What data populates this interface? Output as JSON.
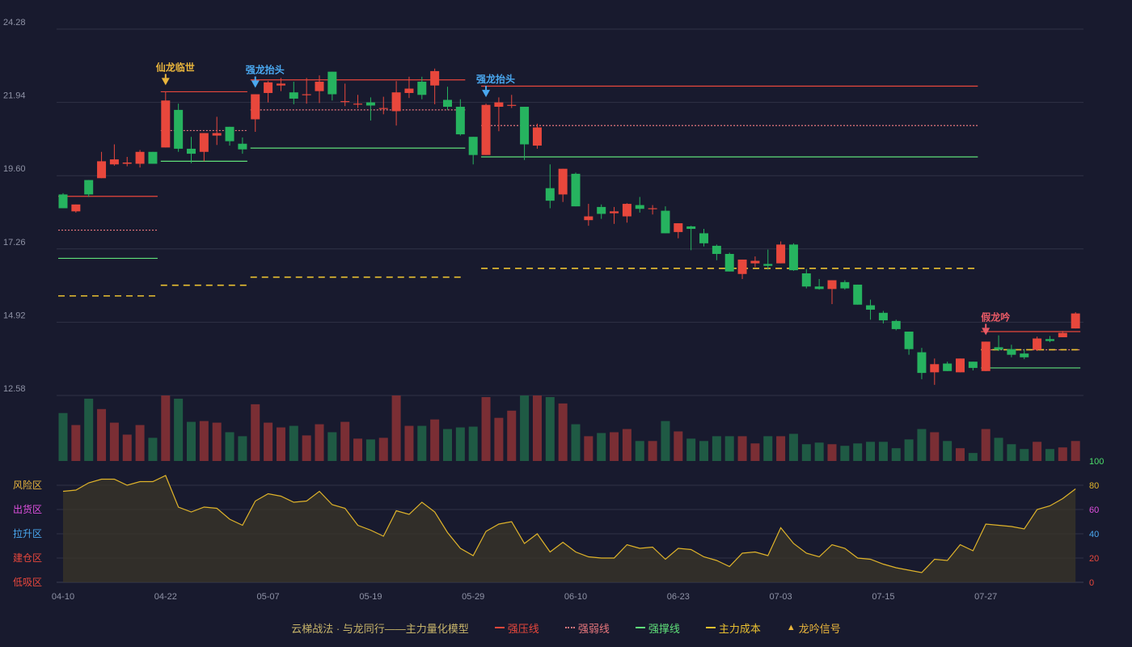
{
  "colors": {
    "background": "#181a2e",
    "up": "#e8473c",
    "down": "#26b35f",
    "up_volume": "#7a2e34",
    "down_volume": "#1f5a44",
    "grid": "#2f3246",
    "strong_pressure": "#e8473c",
    "strong_weak": "#e8777d",
    "strong_support": "#5fe07a",
    "main_cost": "#e9c030",
    "osc_line": "#e0b42a"
  },
  "chart_data": {
    "type": "candlestick",
    "x_ticks": [
      "04-10",
      "04-22",
      "05-07",
      "05-19",
      "05-29",
      "06-10",
      "06-23",
      "07-03",
      "07-15",
      "07-27"
    ],
    "x_tick_index": [
      0,
      8,
      16,
      24,
      32,
      40,
      48,
      56,
      64,
      72
    ],
    "price_axis": {
      "ticks": [
        24.28,
        21.94,
        19.6,
        17.26,
        14.92,
        12.58
      ],
      "ylim": [
        12.58,
        24.28
      ]
    },
    "candles": [
      [
        19.0,
        18.56,
        18.56,
        19.04
      ],
      [
        18.46,
        18.68,
        18.42,
        18.68
      ],
      [
        19.46,
        19.0,
        18.92,
        19.46
      ],
      [
        19.52,
        20.06,
        19.52,
        20.36
      ],
      [
        19.96,
        20.12,
        19.92,
        20.6
      ],
      [
        19.98,
        20.02,
        19.9,
        20.2
      ],
      [
        19.98,
        20.36,
        19.86,
        20.42
      ],
      [
        20.36,
        19.98,
        19.98,
        20.36
      ],
      [
        20.5,
        22.0,
        20.5,
        22.28
      ],
      [
        21.7,
        20.46,
        20.36,
        21.9
      ],
      [
        20.46,
        20.3,
        20.0,
        20.84
      ],
      [
        20.36,
        20.96,
        20.06,
        20.96
      ],
      [
        20.88,
        20.96,
        20.58,
        21.48
      ],
      [
        21.16,
        20.7,
        20.56,
        21.16
      ],
      [
        20.62,
        20.44,
        20.3,
        20.82
      ],
      [
        21.4,
        22.2,
        21.0,
        22.2
      ],
      [
        22.24,
        22.58,
        21.94,
        22.62
      ],
      [
        22.48,
        22.54,
        22.3,
        22.72
      ],
      [
        22.26,
        22.06,
        21.88,
        22.6
      ],
      [
        22.2,
        22.2,
        21.9,
        22.72
      ],
      [
        22.3,
        22.6,
        21.92,
        22.8
      ],
      [
        22.92,
        22.2,
        22.0,
        22.92
      ],
      [
        21.98,
        21.98,
        21.82,
        22.54
      ],
      [
        21.9,
        21.9,
        21.76,
        22.18
      ],
      [
        21.94,
        21.84,
        21.36,
        22.1
      ],
      [
        21.76,
        21.76,
        21.56,
        22.12
      ],
      [
        21.66,
        22.26,
        21.2,
        22.62
      ],
      [
        22.24,
        22.38,
        22.08,
        22.76
      ],
      [
        22.6,
        22.18,
        22.04,
        22.76
      ],
      [
        22.48,
        22.94,
        21.88,
        23.02
      ],
      [
        22.02,
        21.8,
        21.7,
        22.44
      ],
      [
        21.8,
        20.92,
        20.88,
        22.04
      ],
      [
        20.84,
        20.26,
        19.96,
        20.84
      ],
      [
        20.26,
        21.86,
        20.26,
        21.9
      ],
      [
        21.8,
        21.94,
        21.02,
        22.1
      ],
      [
        21.84,
        21.86,
        21.76,
        22.18
      ],
      [
        21.8,
        20.6,
        20.1,
        21.8
      ],
      [
        20.56,
        21.14,
        20.46,
        21.26
      ],
      [
        19.2,
        18.8,
        18.56,
        19.96
      ],
      [
        19.0,
        19.82,
        18.76,
        19.82
      ],
      [
        19.66,
        18.62,
        18.62,
        19.7
      ],
      [
        18.18,
        18.3,
        18.0,
        18.7
      ],
      [
        18.6,
        18.38,
        18.22,
        18.68
      ],
      [
        18.4,
        18.46,
        18.06,
        18.6
      ],
      [
        18.3,
        18.7,
        18.1,
        18.72
      ],
      [
        18.66,
        18.54,
        18.42,
        18.92
      ],
      [
        18.56,
        18.56,
        18.36,
        18.66
      ],
      [
        18.48,
        17.76,
        17.76,
        18.62
      ],
      [
        17.8,
        18.08,
        17.6,
        18.08
      ],
      [
        17.98,
        17.9,
        17.22,
        18.0
      ],
      [
        17.76,
        17.44,
        17.34,
        17.9
      ],
      [
        17.36,
        17.1,
        16.9,
        17.4
      ],
      [
        17.1,
        16.54,
        16.54,
        17.14
      ],
      [
        16.46,
        16.92,
        16.3,
        16.92
      ],
      [
        16.8,
        16.88,
        16.68,
        17.02
      ],
      [
        16.78,
        16.72,
        16.6,
        17.24
      ],
      [
        16.8,
        17.4,
        16.8,
        17.5
      ],
      [
        17.4,
        16.58,
        16.56,
        17.44
      ],
      [
        16.48,
        16.06,
        16.0,
        16.62
      ],
      [
        16.06,
        15.98,
        15.96,
        16.3
      ],
      [
        15.98,
        16.26,
        15.5,
        16.26
      ],
      [
        16.2,
        16.0,
        15.96,
        16.26
      ],
      [
        16.12,
        15.48,
        15.48,
        16.12
      ],
      [
        15.46,
        15.32,
        15.0,
        15.64
      ],
      [
        15.22,
        14.98,
        14.88,
        15.28
      ],
      [
        14.96,
        14.7,
        14.66,
        15.0
      ],
      [
        14.62,
        14.06,
        13.88,
        14.62
      ],
      [
        13.96,
        13.3,
        13.1,
        14.1
      ],
      [
        13.32,
        13.58,
        12.92,
        13.76
      ],
      [
        13.6,
        13.36,
        13.36,
        13.66
      ],
      [
        13.32,
        13.76,
        13.32,
        13.76
      ],
      [
        13.66,
        13.46,
        13.38,
        13.66
      ],
      [
        13.36,
        14.3,
        13.36,
        14.3
      ],
      [
        14.12,
        14.04,
        14.0,
        14.5
      ],
      [
        14.06,
        13.88,
        13.8,
        14.2
      ],
      [
        13.92,
        13.8,
        13.74,
        14.06
      ],
      [
        14.04,
        14.4,
        14.0,
        14.46
      ],
      [
        14.38,
        14.32,
        14.28,
        14.48
      ],
      [
        14.44,
        14.58,
        14.44,
        14.64
      ],
      [
        14.72,
        15.2,
        14.72,
        15.24
      ]
    ],
    "volume": [
      60,
      45,
      78,
      65,
      48,
      33,
      45,
      29,
      82,
      78,
      49,
      50,
      48,
      36,
      31,
      71,
      48,
      42,
      44,
      32,
      46,
      36,
      49,
      28,
      27,
      29,
      82,
      44,
      44,
      52,
      40,
      42,
      43,
      80,
      54,
      63,
      82,
      82,
      80,
      72,
      46,
      31,
      35,
      36,
      40,
      25,
      25,
      50,
      37,
      28,
      25,
      31,
      31,
      31,
      22,
      31,
      31,
      34,
      21,
      23,
      21,
      19,
      22,
      24,
      24,
      16,
      27,
      40,
      36,
      25,
      16,
      10,
      40,
      29,
      21,
      15,
      24,
      15,
      17,
      25
    ],
    "osc_axis": {
      "ticks": [
        0,
        20,
        40,
        60,
        80,
        100
      ]
    },
    "osc_zones": [
      "风险区",
      "出货区",
      "拉升区",
      "建仓区",
      "低吸区"
    ],
    "osc_values": [
      75,
      76,
      82,
      85,
      85,
      80,
      83,
      83,
      88,
      62,
      58,
      62,
      61,
      52,
      47,
      67,
      73,
      71,
      66,
      67,
      75,
      64,
      61,
      47,
      43,
      38,
      59,
      56,
      66,
      58,
      41,
      28,
      22,
      42,
      48,
      50,
      32,
      40,
      25,
      33,
      25,
      21,
      20,
      20,
      31,
      28,
      29,
      19,
      28,
      27,
      21,
      18,
      13,
      24,
      25,
      22,
      45,
      32,
      24,
      21,
      31,
      28,
      20,
      19,
      15,
      12,
      10,
      8,
      19,
      18,
      31,
      26,
      48,
      47,
      46,
      44,
      60,
      63,
      69,
      77
    ],
    "segments": [
      {
        "start": 0,
        "end": 7,
        "strong_pressure": 18.94,
        "strong_weak": 17.86,
        "strong_support": 16.96,
        "main_cost": 15.76
      },
      {
        "start": 8,
        "end": 14,
        "strong_pressure": 22.28,
        "strong_weak": 21.04,
        "strong_support": 20.06,
        "main_cost": 16.1
      },
      {
        "start": 15,
        "end": 31,
        "strong_pressure": 22.66,
        "strong_weak": 21.7,
        "strong_support": 20.48,
        "main_cost": 16.36
      },
      {
        "start": 33,
        "end": 71,
        "strong_pressure": 22.46,
        "strong_weak": 21.2,
        "strong_support": 20.2,
        "main_cost": 16.64
      },
      {
        "start": 72,
        "end": 79,
        "strong_pressure": 14.62,
        "strong_weak": 14.04,
        "strong_support": 13.46,
        "main_cost": 14.04
      }
    ],
    "signals": [
      {
        "index": 8,
        "label": "仙龙临世",
        "color": "#e9b53c"
      },
      {
        "index": 15,
        "label": "强龙抬头",
        "color": "#4aa8f0"
      },
      {
        "index": 33,
        "label": "强龙抬头",
        "color": "#4aa8f0"
      },
      {
        "index": 72,
        "label": "假龙吟",
        "color": "#e85a66"
      }
    ]
  },
  "legend": {
    "title": "云梯战法 · 与龙同行——主力量化模型",
    "strong_pressure": "强压线",
    "strong_weak": "强弱线",
    "strong_support": "强撑线",
    "main_cost": "主力成本",
    "signal": "龙吟信号"
  }
}
